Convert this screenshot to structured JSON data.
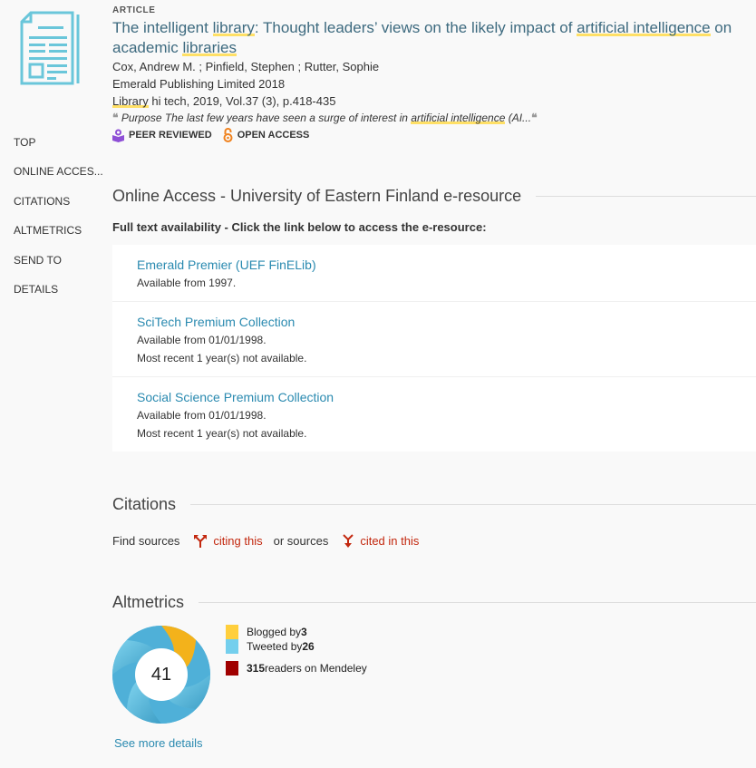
{
  "record": {
    "type_label": "ARTICLE",
    "title_parts": [
      {
        "text": "The intelligent ",
        "hl": false
      },
      {
        "text": "library",
        "hl": true
      },
      {
        "text": ": Thought leaders’ views on the likely impact of ",
        "hl": false
      },
      {
        "text": "artificial intelligence",
        "hl": true
      },
      {
        "text": " on academic ",
        "hl": false
      },
      {
        "text": "libraries",
        "hl": true
      }
    ],
    "authors": "Cox, Andrew M. ; Pinfield, Stephen ; Rutter, Sophie",
    "publisher": "Emerald Publishing Limited 2018",
    "source_hl": "Library",
    "source_rest": " hi tech, 2019, Vol.37 (3), p.418-435",
    "snippet_before": "Purpose The last few years have seen a surge of interest in ",
    "snippet_hl": "artificial intelligence",
    "snippet_after": " (AI...",
    "badges": [
      {
        "label": "PEER REVIEWED",
        "icon": "peer-reviewed-icon",
        "color": "#8e4fd6"
      },
      {
        "label": "OPEN ACCESS",
        "icon": "open-access-icon",
        "color": "#f0821e"
      }
    ]
  },
  "sidenav": {
    "items": [
      "TOP",
      "ONLINE ACCES...",
      "CITATIONS",
      "ALTMETRICS",
      "SEND TO",
      "DETAILS"
    ]
  },
  "online_access": {
    "heading": "Online Access - University of Eastern Finland e-resource",
    "fulltext_label": "Full text availability - Click the link below to access the e-resource:",
    "services": [
      {
        "name": "Emerald Premier (UEF FinELib)",
        "notes": [
          "Available from 1997."
        ]
      },
      {
        "name": "SciTech Premium Collection",
        "notes": [
          "Available from 01/01/1998.",
          "Most recent 1 year(s) not available."
        ]
      },
      {
        "name": "Social Science Premium Collection",
        "notes": [
          "Available from 01/01/1998.",
          "Most recent 1 year(s) not available."
        ]
      }
    ]
  },
  "citations": {
    "heading": "Citations",
    "find_sources": "Find sources",
    "citing_this": "citing this",
    "or_sources": "or sources",
    "cited_in_this": "cited in this"
  },
  "altmetrics": {
    "heading": "Altmetrics",
    "score": "41",
    "legend": [
      {
        "prefix": "Blogged by ",
        "count": "3",
        "suffix": "",
        "color": "#ffcf3d"
      },
      {
        "prefix": "Tweeted by ",
        "count": "26",
        "suffix": "",
        "color": "#74cfed"
      },
      {
        "prefix": "",
        "count": "315",
        "suffix": " readers on Mendeley",
        "color": "#a00000"
      }
    ],
    "see_more": "See more details"
  },
  "colors": {
    "title": "#3d6a7f",
    "link": "#2a8ab0",
    "citation_link": "#c3280f",
    "highlight": "#ffe066",
    "icon": "#5bc0d6"
  }
}
